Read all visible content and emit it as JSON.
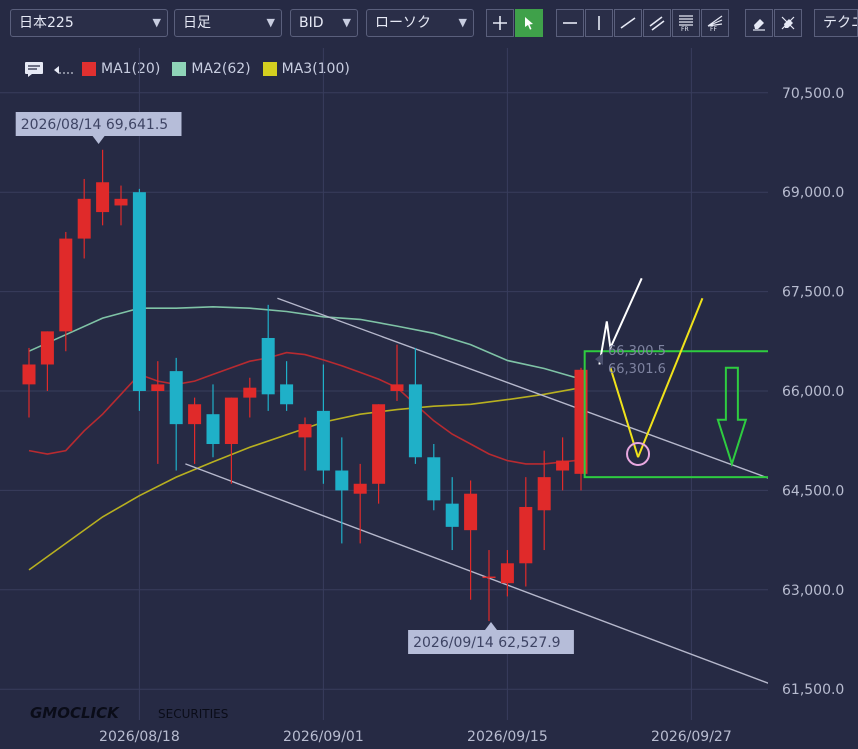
{
  "toolbar": {
    "symbol": "日本225",
    "timeframe": "日足",
    "price_side": "BID",
    "chart_style": "ローソク",
    "tech_label": "テクニ"
  },
  "legend": {
    "items": [
      {
        "label": "MA1(20)",
        "color": "#e03030"
      },
      {
        "label": "MA2(62)",
        "color": "#8fd4b8"
      },
      {
        "label": "MA3(100)",
        "color": "#d4cf20"
      }
    ]
  },
  "brand": {
    "logo": "GMOCLICK",
    "suffix": "SECURITIES"
  },
  "chart_data": {
    "type": "candlestick",
    "y_ticks": [
      "70,500.0",
      "69,000.0",
      "67,500.0",
      "66,000.0",
      "64,500.0",
      "63,000.0",
      "61,500.0"
    ],
    "ylim": [
      61200,
      71000
    ],
    "x_ticks": [
      {
        "label": "2026/08/18",
        "index": 6
      },
      {
        "label": "2026/09/01",
        "index": 16
      },
      {
        "label": "2026/09/15",
        "index": 26
      },
      {
        "label": "2026/09/27",
        "index": 36
      }
    ],
    "x_range": [
      -0.5,
      40.5
    ],
    "high_annotation": {
      "text": "2026/08/14 69,641.5",
      "index": 4,
      "price": 69641.5
    },
    "low_annotation": {
      "text": "2026/09/14 62,527.9",
      "index": 25,
      "price": 62527.9
    },
    "price_labels": {
      "upper": "66,300.5",
      "lower": "66,301.6"
    },
    "candles": [
      {
        "o": 66100,
        "h": 66650,
        "l": 65600,
        "c": 66400
      },
      {
        "o": 66400,
        "h": 66900,
        "l": 66000,
        "c": 66900
      },
      {
        "o": 66900,
        "h": 68400,
        "l": 66600,
        "c": 68300
      },
      {
        "o": 68300,
        "h": 69200,
        "l": 68000,
        "c": 68900
      },
      {
        "o": 68700,
        "h": 69640,
        "l": 68500,
        "c": 69150
      },
      {
        "o": 68800,
        "h": 69100,
        "l": 68500,
        "c": 68900
      },
      {
        "o": 69000,
        "h": 69050,
        "l": 65700,
        "c": 66000
      },
      {
        "o": 66000,
        "h": 66450,
        "l": 64900,
        "c": 66100
      },
      {
        "o": 66300,
        "h": 66500,
        "l": 64800,
        "c": 65500
      },
      {
        "o": 65500,
        "h": 65900,
        "l": 64900,
        "c": 65800
      },
      {
        "o": 65650,
        "h": 66100,
        "l": 65000,
        "c": 65200
      },
      {
        "o": 65200,
        "h": 65900,
        "l": 64600,
        "c": 65900
      },
      {
        "o": 65900,
        "h": 66200,
        "l": 65600,
        "c": 66050
      },
      {
        "o": 66800,
        "h": 67300,
        "l": 65700,
        "c": 65950
      },
      {
        "o": 66100,
        "h": 66450,
        "l": 65700,
        "c": 65800
      },
      {
        "o": 65300,
        "h": 65600,
        "l": 64800,
        "c": 65500
      },
      {
        "o": 65700,
        "h": 66400,
        "l": 64600,
        "c": 64800
      },
      {
        "o": 64800,
        "h": 65300,
        "l": 63700,
        "c": 64500
      },
      {
        "o": 64450,
        "h": 64900,
        "l": 63700,
        "c": 64600
      },
      {
        "o": 64600,
        "h": 65800,
        "l": 64300,
        "c": 65800
      },
      {
        "o": 66000,
        "h": 66700,
        "l": 65850,
        "c": 66100
      },
      {
        "o": 66100,
        "h": 66650,
        "l": 64900,
        "c": 65000
      },
      {
        "o": 65000,
        "h": 65200,
        "l": 64200,
        "c": 64350
      },
      {
        "o": 64300,
        "h": 64700,
        "l": 63600,
        "c": 63950
      },
      {
        "o": 63900,
        "h": 64650,
        "l": 62850,
        "c": 64450
      },
      {
        "o": 63200,
        "h": 63600,
        "l": 62528,
        "c": 63200
      },
      {
        "o": 63100,
        "h": 63600,
        "l": 62900,
        "c": 63400
      },
      {
        "o": 63400,
        "h": 64700,
        "l": 63050,
        "c": 64250
      },
      {
        "o": 64200,
        "h": 65100,
        "l": 63600,
        "c": 64700
      },
      {
        "o": 64800,
        "h": 65300,
        "l": 64500,
        "c": 64950
      },
      {
        "o": 64750,
        "h": 66350,
        "l": 64500,
        "c": 66320
      }
    ],
    "series": [
      {
        "name": "MA1(20)",
        "color": "#b82a30",
        "points": [
          [
            0,
            65100
          ],
          [
            1,
            65050
          ],
          [
            2,
            65100
          ],
          [
            3,
            65400
          ],
          [
            4,
            65650
          ],
          [
            5,
            65950
          ],
          [
            6,
            66250
          ],
          [
            7,
            66150
          ],
          [
            8,
            66100
          ],
          [
            9,
            66150
          ],
          [
            10,
            66250
          ],
          [
            11,
            66350
          ],
          [
            12,
            66450
          ],
          [
            13,
            66500
          ],
          [
            14,
            66580
          ],
          [
            15,
            66550
          ],
          [
            16,
            66470
          ],
          [
            17,
            66380
          ],
          [
            18,
            66280
          ],
          [
            19,
            66180
          ],
          [
            20,
            66050
          ],
          [
            21,
            65800
          ],
          [
            22,
            65550
          ],
          [
            23,
            65350
          ],
          [
            24,
            65200
          ],
          [
            25,
            65050
          ],
          [
            26,
            64950
          ],
          [
            27,
            64900
          ],
          [
            28,
            64900
          ],
          [
            29,
            64930
          ],
          [
            30,
            64960
          ]
        ]
      },
      {
        "name": "MA2(62)",
        "color": "#7fc3a6",
        "points": [
          [
            0,
            66600
          ],
          [
            2,
            66850
          ],
          [
            4,
            67100
          ],
          [
            6,
            67250
          ],
          [
            8,
            67250
          ],
          [
            10,
            67270
          ],
          [
            12,
            67250
          ],
          [
            14,
            67200
          ],
          [
            16,
            67120
          ],
          [
            18,
            67080
          ],
          [
            20,
            66980
          ],
          [
            22,
            66870
          ],
          [
            24,
            66700
          ],
          [
            26,
            66460
          ],
          [
            28,
            66340
          ],
          [
            30,
            66180
          ]
        ]
      },
      {
        "name": "MA3(100)",
        "color": "#b8b020",
        "points": [
          [
            0,
            63300
          ],
          [
            2,
            63700
          ],
          [
            4,
            64100
          ],
          [
            6,
            64420
          ],
          [
            8,
            64700
          ],
          [
            10,
            64930
          ],
          [
            12,
            65150
          ],
          [
            14,
            65340
          ],
          [
            16,
            65530
          ],
          [
            18,
            65650
          ],
          [
            20,
            65720
          ],
          [
            22,
            65770
          ],
          [
            24,
            65800
          ],
          [
            26,
            65870
          ],
          [
            28,
            65950
          ],
          [
            30,
            66050
          ]
        ]
      }
    ],
    "trendlines": [
      {
        "color": "#b6b8cc",
        "points": [
          [
            13.5,
            67400
          ],
          [
            42,
            64500
          ]
        ]
      },
      {
        "color": "#b6b8cc",
        "points": [
          [
            8.5,
            64900
          ],
          [
            42,
            61400
          ]
        ]
      }
    ],
    "annotations": {
      "white_zigzag": [
        [
          31,
          66400
        ],
        [
          31.4,
          67050
        ],
        [
          31.6,
          66650
        ],
        [
          33.3,
          67700
        ]
      ],
      "yellow_lines": [
        [
          [
            31.6,
            66350
          ],
          [
            33.1,
            65000
          ]
        ],
        [
          [
            33.1,
            65000
          ],
          [
            36.6,
            67400
          ]
        ]
      ],
      "circle": {
        "index": 33.1,
        "price": 65050
      },
      "green_box": {
        "x0": 30.2,
        "x1": 45.5,
        "p0": 64700,
        "p1": 66600
      },
      "green_arrow": {
        "index": 38.2,
        "top": 66350,
        "bottom": 64900
      }
    }
  }
}
